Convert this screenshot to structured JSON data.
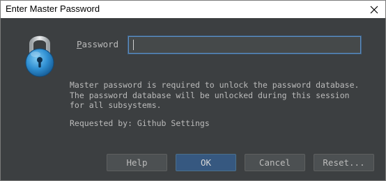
{
  "window": {
    "title": "Enter Master Password",
    "close_icon": "close-icon"
  },
  "lock_icon": "padlock-icon",
  "password": {
    "label_prefix": "",
    "label_mnemonic": "P",
    "label_rest": "assword",
    "value": ""
  },
  "message": {
    "text": "Master password is required to unlock the password database.\nThe password database will be unlocked during this session\nfor all subsystems."
  },
  "requested_by": {
    "text": "Requested by: Github Settings"
  },
  "buttons": {
    "help": "Help",
    "ok": "OK",
    "cancel": "Cancel",
    "reset": "Reset..."
  },
  "colors": {
    "background": "#3c3f41",
    "text": "#bbbbbb",
    "default_button": "#365880",
    "focus_border": "#5e8fc4",
    "lock_blue": "#2f8fd2"
  }
}
